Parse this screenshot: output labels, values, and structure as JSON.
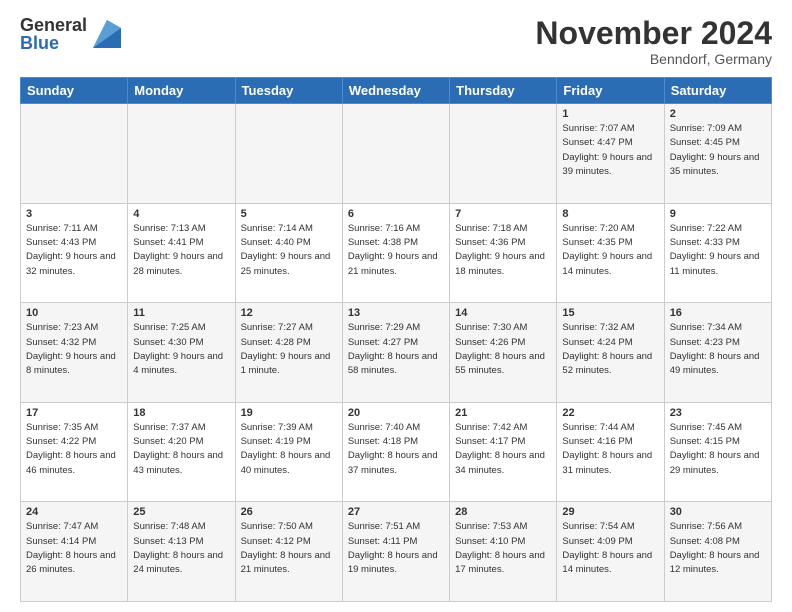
{
  "logo": {
    "general": "General",
    "blue": "Blue"
  },
  "header": {
    "month": "November 2024",
    "location": "Benndorf, Germany"
  },
  "weekdays": [
    "Sunday",
    "Monday",
    "Tuesday",
    "Wednesday",
    "Thursday",
    "Friday",
    "Saturday"
  ],
  "weeks": [
    [
      {
        "day": "",
        "sunrise": "",
        "sunset": "",
        "daylight": ""
      },
      {
        "day": "",
        "sunrise": "",
        "sunset": "",
        "daylight": ""
      },
      {
        "day": "",
        "sunrise": "",
        "sunset": "",
        "daylight": ""
      },
      {
        "day": "",
        "sunrise": "",
        "sunset": "",
        "daylight": ""
      },
      {
        "day": "",
        "sunrise": "",
        "sunset": "",
        "daylight": ""
      },
      {
        "day": "1",
        "sunrise": "Sunrise: 7:07 AM",
        "sunset": "Sunset: 4:47 PM",
        "daylight": "Daylight: 9 hours and 39 minutes."
      },
      {
        "day": "2",
        "sunrise": "Sunrise: 7:09 AM",
        "sunset": "Sunset: 4:45 PM",
        "daylight": "Daylight: 9 hours and 35 minutes."
      }
    ],
    [
      {
        "day": "3",
        "sunrise": "Sunrise: 7:11 AM",
        "sunset": "Sunset: 4:43 PM",
        "daylight": "Daylight: 9 hours and 32 minutes."
      },
      {
        "day": "4",
        "sunrise": "Sunrise: 7:13 AM",
        "sunset": "Sunset: 4:41 PM",
        "daylight": "Daylight: 9 hours and 28 minutes."
      },
      {
        "day": "5",
        "sunrise": "Sunrise: 7:14 AM",
        "sunset": "Sunset: 4:40 PM",
        "daylight": "Daylight: 9 hours and 25 minutes."
      },
      {
        "day": "6",
        "sunrise": "Sunrise: 7:16 AM",
        "sunset": "Sunset: 4:38 PM",
        "daylight": "Daylight: 9 hours and 21 minutes."
      },
      {
        "day": "7",
        "sunrise": "Sunrise: 7:18 AM",
        "sunset": "Sunset: 4:36 PM",
        "daylight": "Daylight: 9 hours and 18 minutes."
      },
      {
        "day": "8",
        "sunrise": "Sunrise: 7:20 AM",
        "sunset": "Sunset: 4:35 PM",
        "daylight": "Daylight: 9 hours and 14 minutes."
      },
      {
        "day": "9",
        "sunrise": "Sunrise: 7:22 AM",
        "sunset": "Sunset: 4:33 PM",
        "daylight": "Daylight: 9 hours and 11 minutes."
      }
    ],
    [
      {
        "day": "10",
        "sunrise": "Sunrise: 7:23 AM",
        "sunset": "Sunset: 4:32 PM",
        "daylight": "Daylight: 9 hours and 8 minutes."
      },
      {
        "day": "11",
        "sunrise": "Sunrise: 7:25 AM",
        "sunset": "Sunset: 4:30 PM",
        "daylight": "Daylight: 9 hours and 4 minutes."
      },
      {
        "day": "12",
        "sunrise": "Sunrise: 7:27 AM",
        "sunset": "Sunset: 4:28 PM",
        "daylight": "Daylight: 9 hours and 1 minute."
      },
      {
        "day": "13",
        "sunrise": "Sunrise: 7:29 AM",
        "sunset": "Sunset: 4:27 PM",
        "daylight": "Daylight: 8 hours and 58 minutes."
      },
      {
        "day": "14",
        "sunrise": "Sunrise: 7:30 AM",
        "sunset": "Sunset: 4:26 PM",
        "daylight": "Daylight: 8 hours and 55 minutes."
      },
      {
        "day": "15",
        "sunrise": "Sunrise: 7:32 AM",
        "sunset": "Sunset: 4:24 PM",
        "daylight": "Daylight: 8 hours and 52 minutes."
      },
      {
        "day": "16",
        "sunrise": "Sunrise: 7:34 AM",
        "sunset": "Sunset: 4:23 PM",
        "daylight": "Daylight: 8 hours and 49 minutes."
      }
    ],
    [
      {
        "day": "17",
        "sunrise": "Sunrise: 7:35 AM",
        "sunset": "Sunset: 4:22 PM",
        "daylight": "Daylight: 8 hours and 46 minutes."
      },
      {
        "day": "18",
        "sunrise": "Sunrise: 7:37 AM",
        "sunset": "Sunset: 4:20 PM",
        "daylight": "Daylight: 8 hours and 43 minutes."
      },
      {
        "day": "19",
        "sunrise": "Sunrise: 7:39 AM",
        "sunset": "Sunset: 4:19 PM",
        "daylight": "Daylight: 8 hours and 40 minutes."
      },
      {
        "day": "20",
        "sunrise": "Sunrise: 7:40 AM",
        "sunset": "Sunset: 4:18 PM",
        "daylight": "Daylight: 8 hours and 37 minutes."
      },
      {
        "day": "21",
        "sunrise": "Sunrise: 7:42 AM",
        "sunset": "Sunset: 4:17 PM",
        "daylight": "Daylight: 8 hours and 34 minutes."
      },
      {
        "day": "22",
        "sunrise": "Sunrise: 7:44 AM",
        "sunset": "Sunset: 4:16 PM",
        "daylight": "Daylight: 8 hours and 31 minutes."
      },
      {
        "day": "23",
        "sunrise": "Sunrise: 7:45 AM",
        "sunset": "Sunset: 4:15 PM",
        "daylight": "Daylight: 8 hours and 29 minutes."
      }
    ],
    [
      {
        "day": "24",
        "sunrise": "Sunrise: 7:47 AM",
        "sunset": "Sunset: 4:14 PM",
        "daylight": "Daylight: 8 hours and 26 minutes."
      },
      {
        "day": "25",
        "sunrise": "Sunrise: 7:48 AM",
        "sunset": "Sunset: 4:13 PM",
        "daylight": "Daylight: 8 hours and 24 minutes."
      },
      {
        "day": "26",
        "sunrise": "Sunrise: 7:50 AM",
        "sunset": "Sunset: 4:12 PM",
        "daylight": "Daylight: 8 hours and 21 minutes."
      },
      {
        "day": "27",
        "sunrise": "Sunrise: 7:51 AM",
        "sunset": "Sunset: 4:11 PM",
        "daylight": "Daylight: 8 hours and 19 minutes."
      },
      {
        "day": "28",
        "sunrise": "Sunrise: 7:53 AM",
        "sunset": "Sunset: 4:10 PM",
        "daylight": "Daylight: 8 hours and 17 minutes."
      },
      {
        "day": "29",
        "sunrise": "Sunrise: 7:54 AM",
        "sunset": "Sunset: 4:09 PM",
        "daylight": "Daylight: 8 hours and 14 minutes."
      },
      {
        "day": "30",
        "sunrise": "Sunrise: 7:56 AM",
        "sunset": "Sunset: 4:08 PM",
        "daylight": "Daylight: 8 hours and 12 minutes."
      }
    ]
  ]
}
